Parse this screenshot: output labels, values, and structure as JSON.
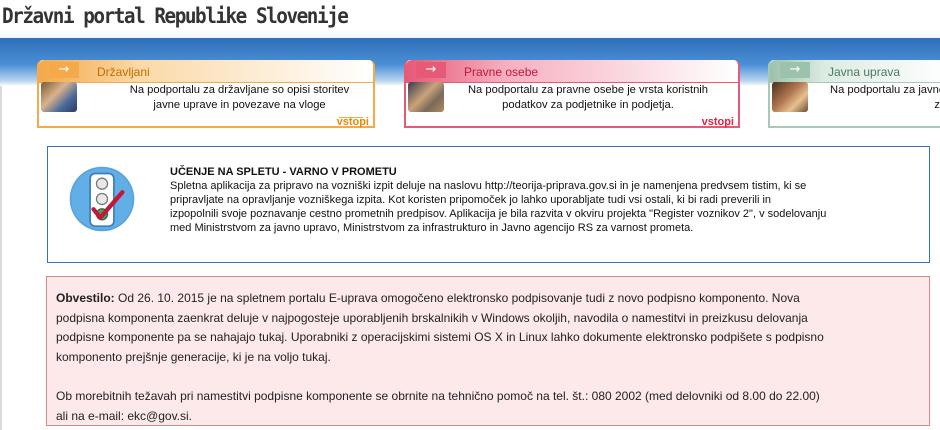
{
  "header": {
    "site_title": "Državni portal Republike Slovenije"
  },
  "colors": {
    "banner_blue": "#3a7ec8",
    "citizens_accent": "#f4a94a",
    "business_accent": "#e65a78",
    "public_admin_accent": "#9cc2ac",
    "notice_background": "#fde8ea"
  },
  "entry_cards": [
    {
      "arrow_icon": "arrow-right-icon",
      "title": "Državljani",
      "text_line1": "Na podportalu za državljane so opisi storitev",
      "text_line2": "javne uprave in povezave na vloge",
      "link_label": "vstopi"
    },
    {
      "arrow_icon": "arrow-right-icon",
      "title": "Pravne osebe",
      "text_line1": "Na podportalu za pravne osebe je vrsta koristnih",
      "text_line2": "podatkov za podjetnike in podjetja.",
      "link_label": "vstopi"
    },
    {
      "arrow_icon": "arrow-right-icon",
      "title": "Javna uprava",
      "text_line1": "Na podportalu za javne",
      "text_line2": "z"
    }
  ],
  "learning_box": {
    "icon": "traffic-light-icon",
    "title": "UČENJE NA SPLETU - VARNO V PROMETU",
    "lines": [
      "Spletna aplikacija za pripravo na vozniški izpit deluje na naslovu http://teorija-priprava.gov.si in je namenjena predvsem tistim, ki se",
      "pripravljate na opravljanje vozniškega izpita. Kot koristen pripomoček jo lahko uporabljate tudi vsi ostali, ki bi radi preverili in",
      "izpopolnili svoje poznavanje cestno prometnih predpisov. Aplikacija je bila razvita v okviru projekta \"Register voznikov 2\", v sodelovanju",
      "med Ministrstvom za javno upravo, Ministrstvom za infrastrukturo in Javno agencijo RS za varnost prometa."
    ]
  },
  "notice": {
    "label": "Obvestilo:",
    "line1_rest": " Od 26. 10. 2015 je na spletnem portalu E-uprava omogočeno elektronsko podpisovanje tudi z novo podpisno komponento. Nova",
    "lines": [
      "podpisna komponenta zaenkrat deluje v najpogosteje uporabljenih brskalnikih v Windows okoljih, navodila o namestitvi in preizkusu delovanja",
      "podpisne komponente pa se nahajajo tukaj. Uporabniki z operacijskimi sistemi OS X in Linux lahko dokumente elektronsko podpišete s podpisno",
      "komponento prejšnje generacije, ki je na voljo tukaj."
    ],
    "help_line1": "Ob morebitnih težavah pri namestitvi podpisne komponente se obrnite na tehnično pomoč na tel. št.: 080 2002 (med delovniki od 8.00 do 22.00)",
    "help_line2": "ali na e-mail: ekc@gov.si."
  }
}
